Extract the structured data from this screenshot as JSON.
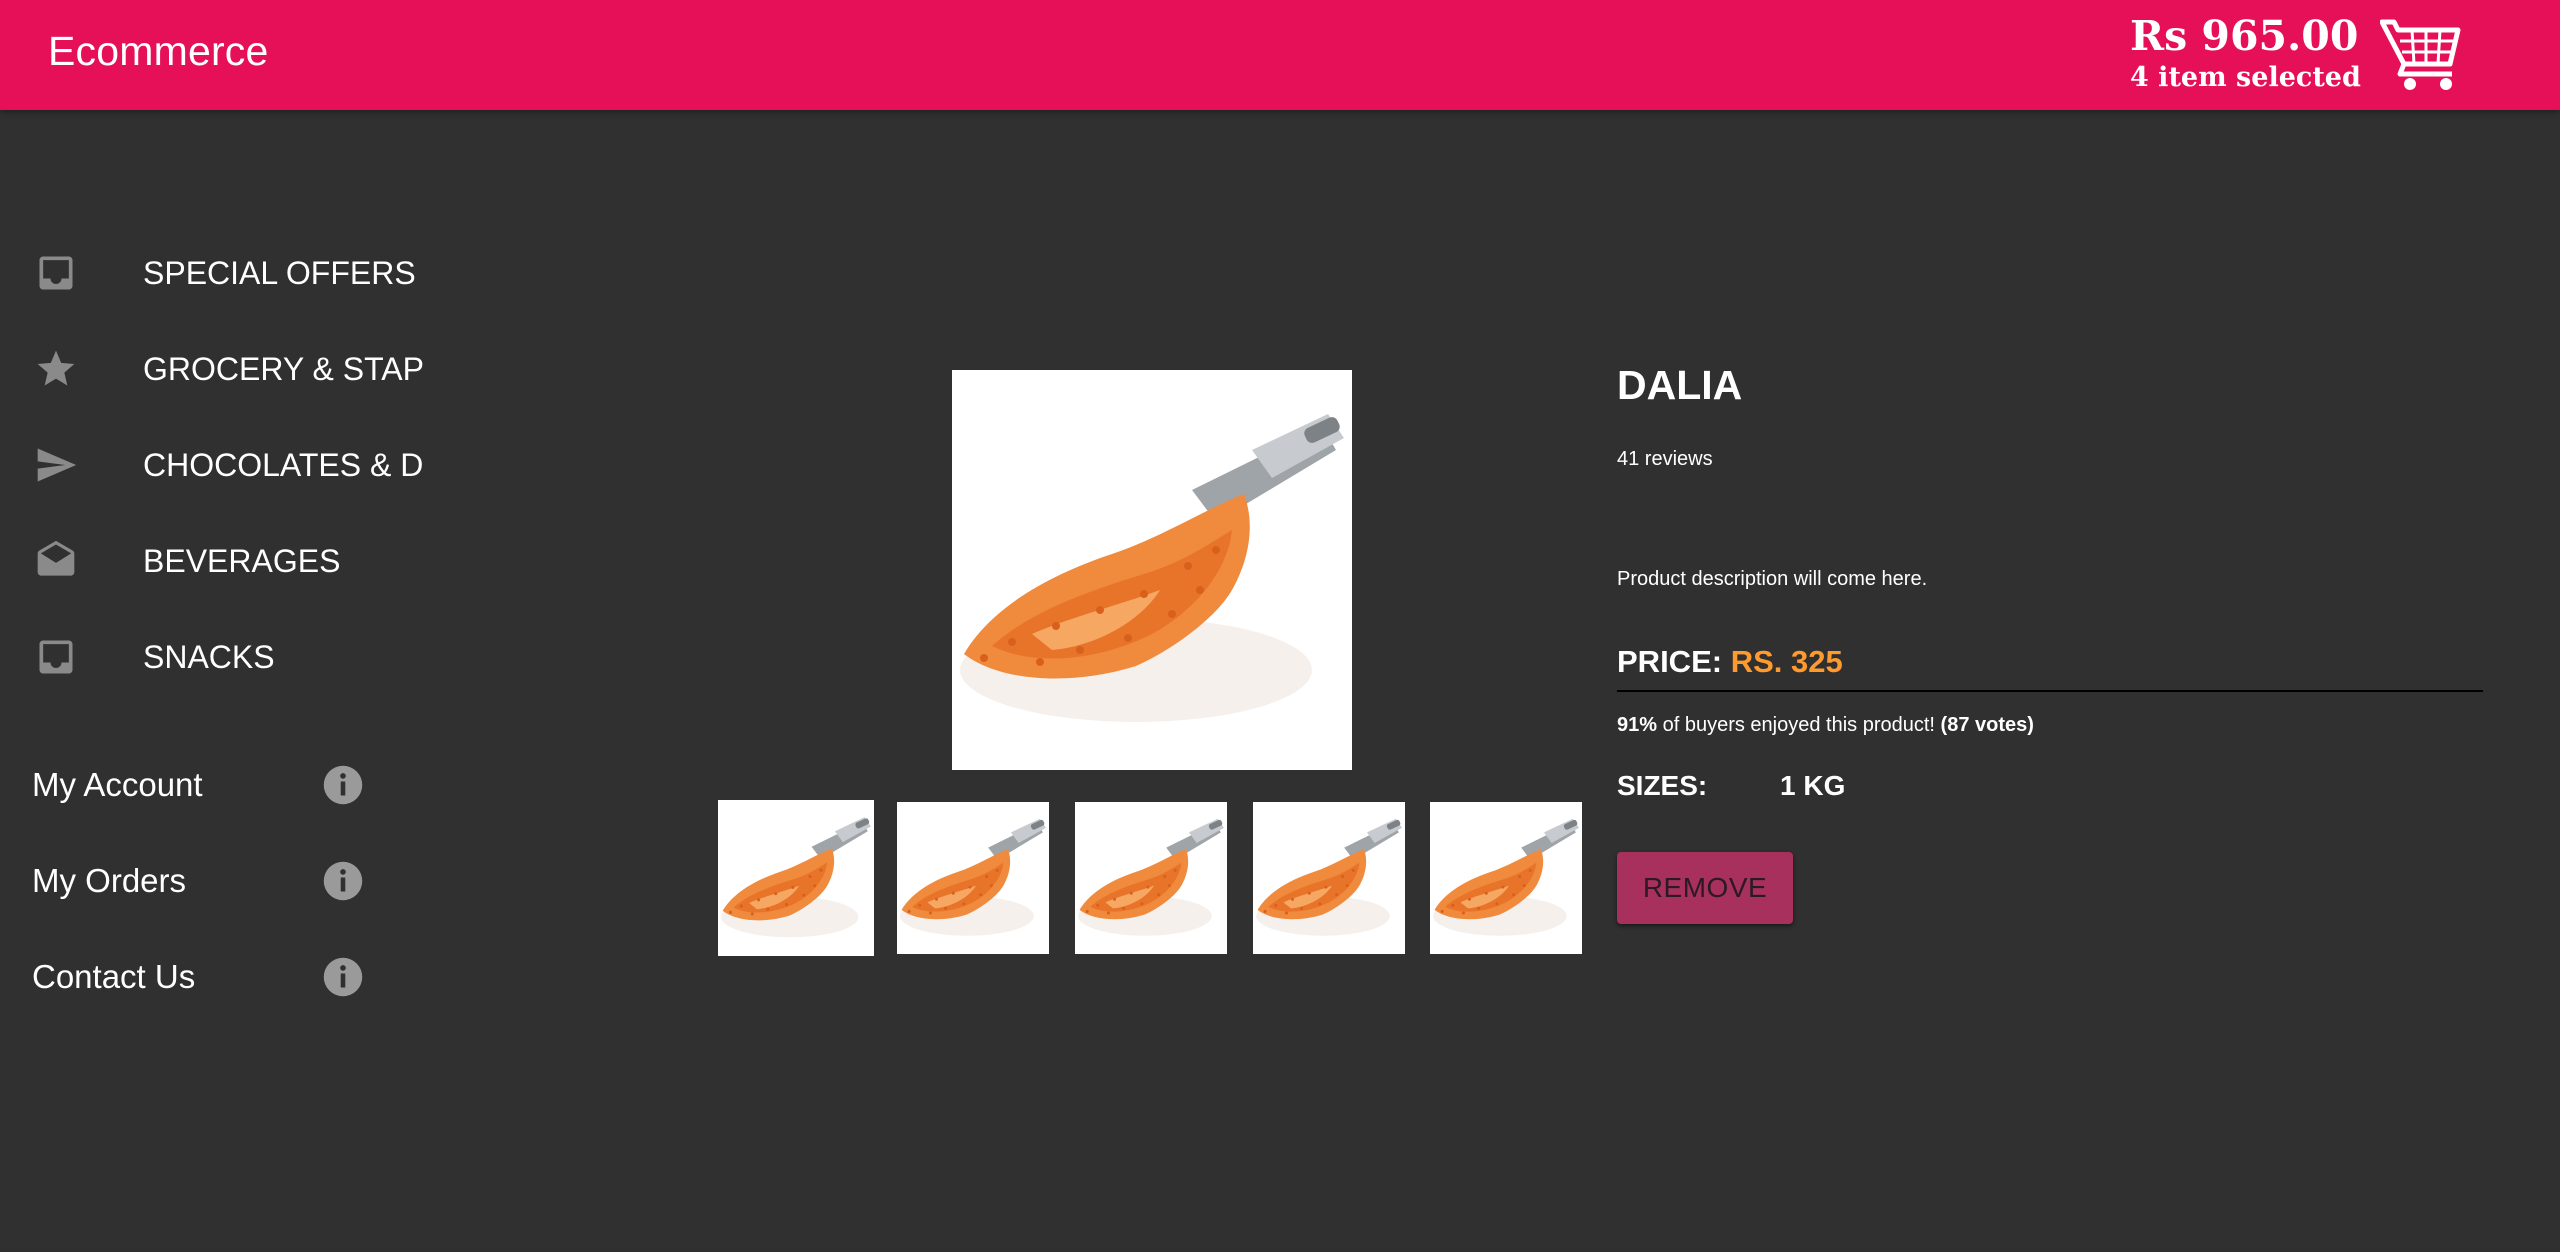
{
  "appbar": {
    "title": "Ecommerce",
    "cart_total": "Rs 965.00",
    "cart_count_text": "4 item selected",
    "cart_icon": "shopping-cart-icon",
    "bg_color": "#e51058"
  },
  "sidebar": {
    "categories": [
      {
        "label": "SPECIAL OFFERS",
        "icon": "inbox-icon"
      },
      {
        "label": "GROCERY & STAP",
        "icon": "star-icon"
      },
      {
        "label": "CHOCOLATES & D",
        "icon": "send-icon"
      },
      {
        "label": "BEVERAGES",
        "icon": "drafts-icon"
      },
      {
        "label": "SNACKS",
        "icon": "inbox-icon"
      }
    ],
    "links": [
      {
        "label": "My Account",
        "icon": "info-icon"
      },
      {
        "label": "My Orders",
        "icon": "info-icon"
      },
      {
        "label": "Contact Us",
        "icon": "info-icon"
      }
    ]
  },
  "product": {
    "name": "DALIA",
    "reviews": "41 reviews",
    "description": "Product description will come here.",
    "price_label": "PRICE:",
    "price_value": "RS. 325",
    "votes": {
      "percent": "91%",
      "text": " of buyers enjoyed this product! ",
      "count": "(87 votes)"
    },
    "sizes_label": "SIZES:",
    "size": "1 KG",
    "remove_label": "REMOVE",
    "image_icon": "red-lentils-image",
    "thumbnail_count": 5,
    "colors": {
      "price": "#ff9a2e",
      "remove_button": "#a8305c"
    }
  }
}
